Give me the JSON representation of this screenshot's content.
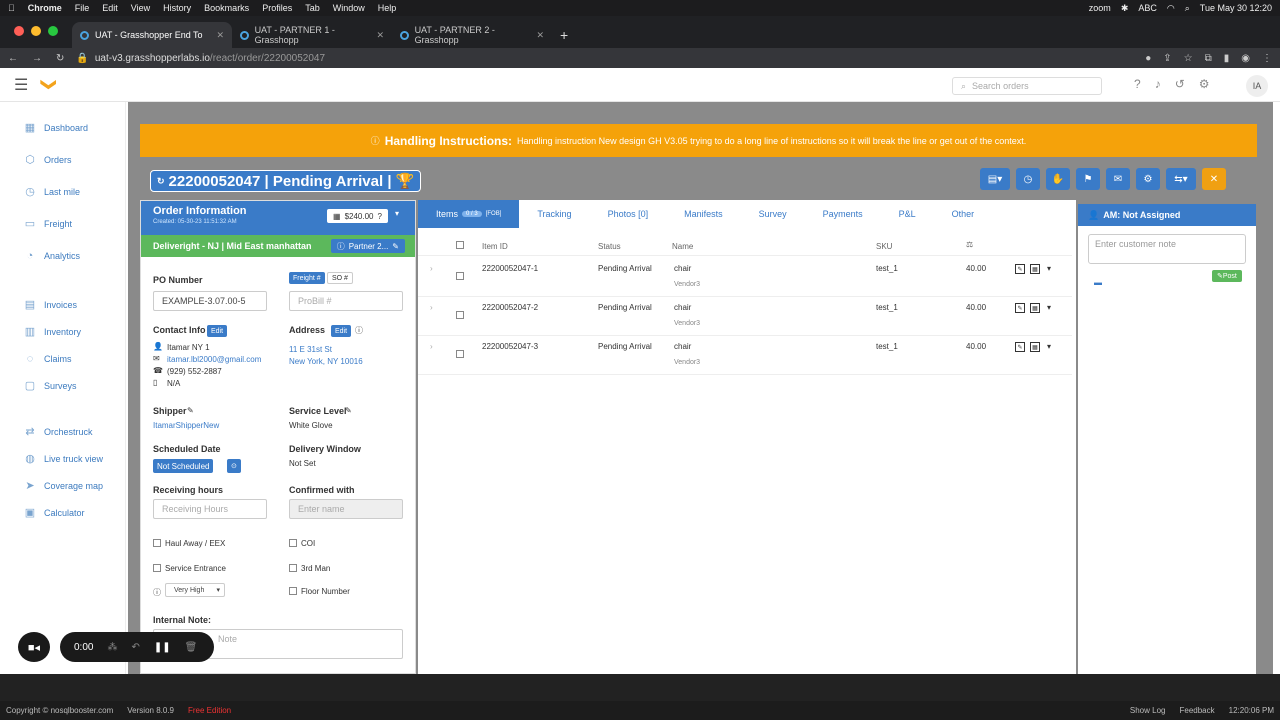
{
  "menubar": {
    "apple": "",
    "app": "Chrome",
    "items": [
      "File",
      "Edit",
      "View",
      "History",
      "Bookmarks",
      "Profiles",
      "Tab",
      "Window",
      "Help"
    ],
    "zoom": "zoom",
    "abc": "ABC",
    "datetime": "Tue May 30  12:20"
  },
  "tabs": [
    {
      "label": "UAT - Grasshopper End To"
    },
    {
      "label": "UAT - PARTNER 1 - Grasshopp"
    },
    {
      "label": "UAT - PARTNER 2 - Grasshopp"
    }
  ],
  "url": {
    "host": "uat-v3.grasshopperlabs.io",
    "path": "/react/order/22200052047"
  },
  "topnav": {
    "search_placeholder": "Search orders",
    "avatar": "IA"
  },
  "sidebar": [
    "Dashboard",
    "Orders",
    "Last mile",
    "Freight",
    "Analytics",
    "Invoices",
    "Inventory",
    "Claims",
    "Surveys",
    "Orchestruck",
    "Live truck view",
    "Coverage map",
    "Calculator"
  ],
  "handling": {
    "label": "Handling Instructions:",
    "text": "Handling instruction New design GH V3.05 trying to do a long line of instructions so it will break the line or get out of the context."
  },
  "order": {
    "title": "22200052047 | Pending Arrival |"
  },
  "info": {
    "heading": "Order Information",
    "created": "Created: 05-30-23 11:51:32 AM",
    "price": "$240.00",
    "partner_line": "Deliveright - NJ | Mid East manhattan",
    "partner_btn": "Partner 2...",
    "po_label": "PO Number",
    "po_value": "EXAMPLE-3.07.00-5",
    "freight_chip": "Freight #",
    "so_chip": "SO #",
    "probill_ph": "ProBill #",
    "contact_label": "Contact Info",
    "edit": "Edit",
    "contact_name": "Itamar NY 1",
    "contact_email": "itamar.lbl2000@gmail.com",
    "contact_phone": "(929) 552-2887",
    "contact_na": "N/A",
    "address_label": "Address",
    "address_line1": "11 E 31st St",
    "address_line2": "New York, NY 10016",
    "shipper_label": "Shipper",
    "shipper_value": "ItamarShipperNew",
    "service_label": "Service Level",
    "service_value": "White Glove",
    "sched_label": "Scheduled Date",
    "sched_value": "Not Scheduled",
    "window_label": "Delivery Window",
    "window_value": "Not Set",
    "recv_label": "Receiving hours",
    "recv_ph": "Receiving Hours",
    "confirmed_label": "Confirmed with",
    "confirmed_ph": "Enter name",
    "cb_haul": "Haul Away / EEX",
    "cb_coi": "COI",
    "cb_service": "Service Entrance",
    "cb_3rd": "3rd Man",
    "priority": "Very High",
    "cb_floor": "Floor Number",
    "note_label": "Internal Note:",
    "note_ph": "Note"
  },
  "item_tabs": {
    "items": "Items",
    "badge": "0 / 3",
    "fob": "[FOB]",
    "others": [
      "Tracking",
      "Photos [0]",
      "Manifests",
      "Survey",
      "Payments",
      "P&L",
      "Other"
    ]
  },
  "table": {
    "headers": [
      "Item ID",
      "Status",
      "Name",
      "SKU"
    ],
    "rows": [
      {
        "id": "22200052047-1",
        "status": "Pending Arrival",
        "name": "chair",
        "vendor": "Vendor3",
        "sku": "test_1",
        "value": "40.00"
      },
      {
        "id": "22200052047-2",
        "status": "Pending Arrival",
        "name": "chair",
        "vendor": "Vendor3",
        "sku": "test_1",
        "value": "40.00"
      },
      {
        "id": "22200052047-3",
        "status": "Pending Arrival",
        "name": "chair",
        "vendor": "Vendor3",
        "sku": "test_1",
        "value": "40.00"
      }
    ]
  },
  "am": {
    "heading": "AM: Not Assigned",
    "note_ph": "Enter customer note",
    "post": "Post"
  },
  "recorder": {
    "time": "0:00"
  },
  "statusbar": {
    "copyright": "Copyright © nosqlbooster.com",
    "version": "Version 8.0.9",
    "edition": "Free Edition",
    "show_log": "Show Log",
    "feedback": "Feedback",
    "time": "12:20:06 PM"
  }
}
